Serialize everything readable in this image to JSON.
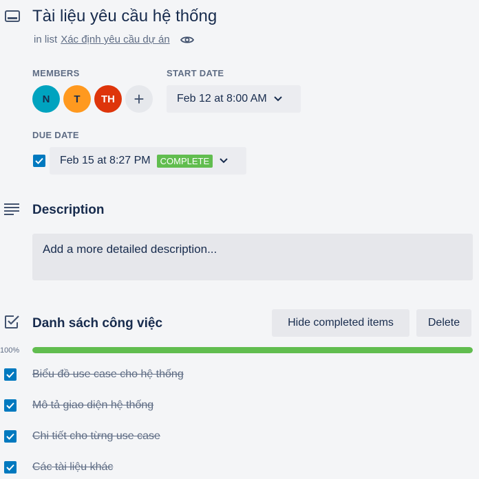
{
  "card": {
    "title": "Tài liệu yêu cầu hệ thống",
    "in_list_prefix": "in list",
    "list_name": "Xác định yêu cầu dự án"
  },
  "members": {
    "label": "MEMBERS",
    "avatars": [
      {
        "initials": "N",
        "color": "#00a3bf"
      },
      {
        "initials": "T",
        "color": "#ff991f"
      },
      {
        "initials": "TH",
        "color": "#de350b"
      }
    ],
    "add_symbol": "+"
  },
  "start_date": {
    "label": "START DATE",
    "value": "Feb 12 at 8:00 AM"
  },
  "due_date": {
    "label": "DUE DATE",
    "checked": true,
    "value": "Feb 15 at 8:27 PM",
    "status": "COMPLETE"
  },
  "description": {
    "heading": "Description",
    "placeholder": "Add a more detailed description..."
  },
  "checklist": {
    "title": "Danh sách công việc",
    "hide_button": "Hide completed items",
    "delete_button": "Delete",
    "progress_label": "100%",
    "progress": 1.0,
    "items": [
      {
        "text": "Biểu đồ use case cho hệ thống",
        "checked": true
      },
      {
        "text": "Mô tả giao diện hệ thống",
        "checked": true
      },
      {
        "text": "Chi tiết cho từng use case",
        "checked": true
      },
      {
        "text": "Các tài liệu khác",
        "checked": true
      }
    ]
  },
  "colors": {
    "accent": "#0079bf",
    "complete_green": "#61bd4f"
  }
}
